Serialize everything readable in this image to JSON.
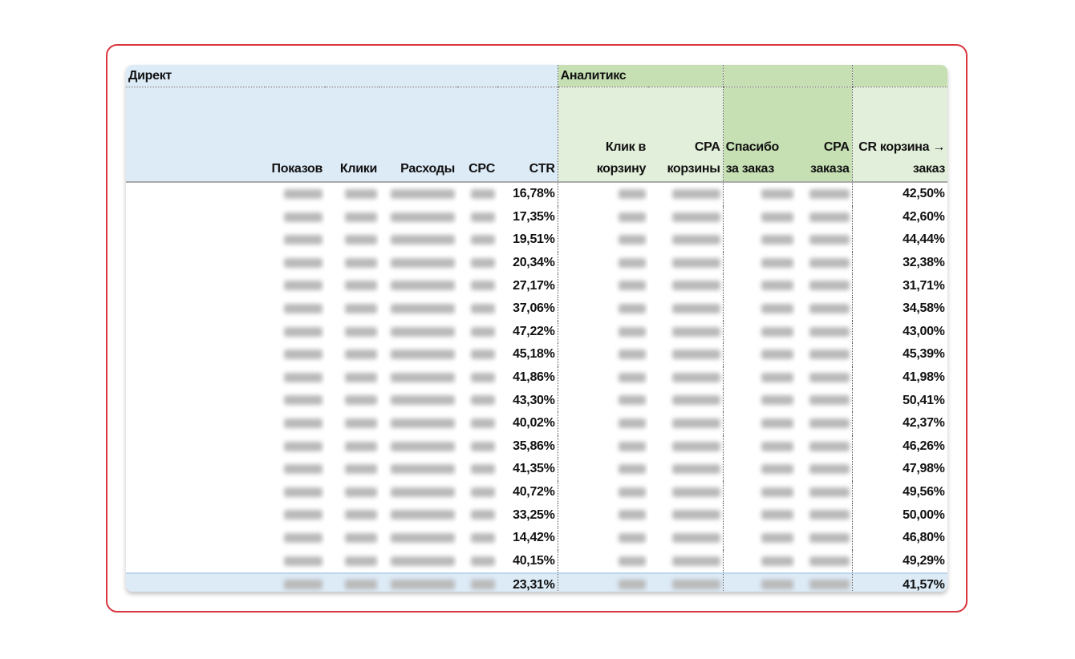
{
  "header": {
    "group_direct": "Директ",
    "group_analytics": "Аналитикс",
    "columns": [
      "Показов",
      "Клики",
      "Расходы",
      "CPC",
      "CTR",
      "Клик в корзину",
      "CPA корзины",
      "Спасибо за заказ",
      "CPA заказа",
      "CR корзина → заказ"
    ]
  },
  "rows": [
    {
      "ctr": "16,78%",
      "cr": "42,50%"
    },
    {
      "ctr": "17,35%",
      "cr": "42,60%"
    },
    {
      "ctr": "19,51%",
      "cr": "44,44%"
    },
    {
      "ctr": "20,34%",
      "cr": "32,38%"
    },
    {
      "ctr": "27,17%",
      "cr": "31,71%"
    },
    {
      "ctr": "37,06%",
      "cr": "34,58%"
    },
    {
      "ctr": "47,22%",
      "cr": "43,00%"
    },
    {
      "ctr": "45,18%",
      "cr": "45,39%"
    },
    {
      "ctr": "41,86%",
      "cr": "41,98%"
    },
    {
      "ctr": "43,30%",
      "cr": "50,41%"
    },
    {
      "ctr": "40,02%",
      "cr": "42,37%"
    },
    {
      "ctr": "35,86%",
      "cr": "46,26%"
    },
    {
      "ctr": "41,35%",
      "cr": "47,98%"
    },
    {
      "ctr": "40,72%",
      "cr": "49,56%"
    },
    {
      "ctr": "33,25%",
      "cr": "50,00%"
    },
    {
      "ctr": "14,42%",
      "cr": "46,80%"
    },
    {
      "ctr": "40,15%",
      "cr": "49,29%"
    }
  ],
  "total": {
    "ctr": "23,31%",
    "cr": "41,57%"
  },
  "colors": {
    "frame": "#d9363e",
    "direct_bg": "#ddebf7",
    "analytics_light": "#e2efda",
    "analytics_dark": "#c6e0b4"
  }
}
